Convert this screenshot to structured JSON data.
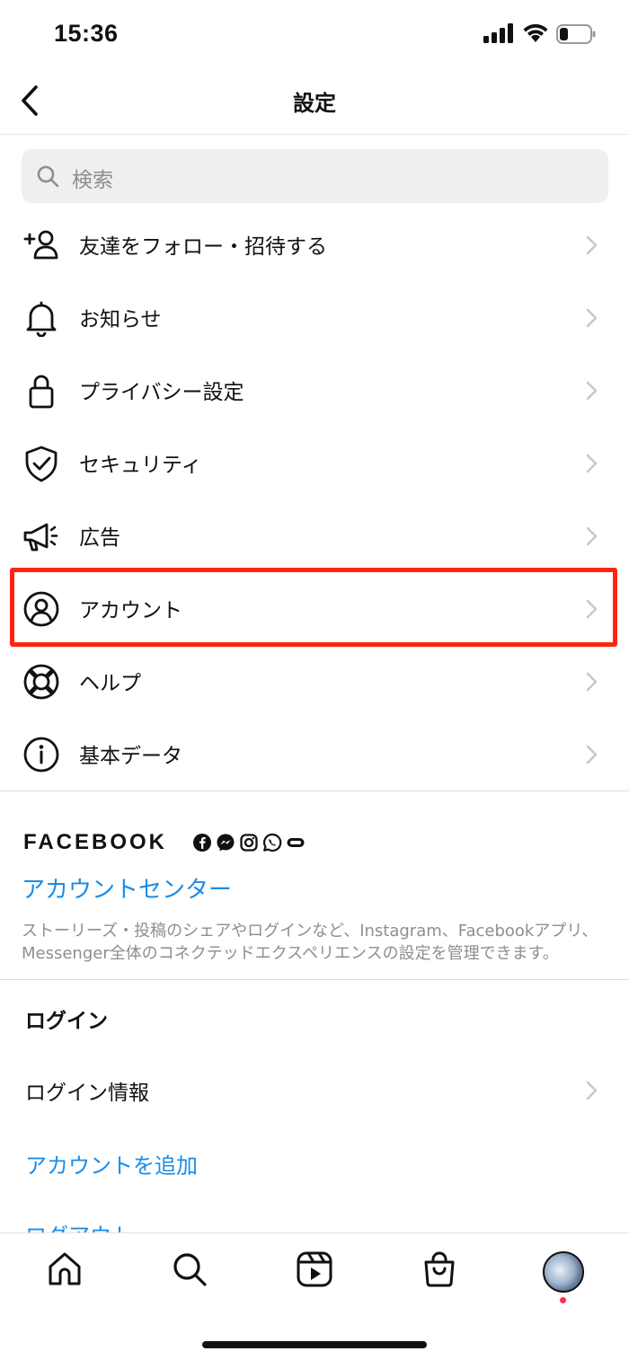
{
  "status_bar": {
    "time": "15:36"
  },
  "header": {
    "title": "設定"
  },
  "search": {
    "placeholder": "検索"
  },
  "menu": [
    {
      "label": "友達をフォロー・招待する",
      "icon": "add-person-icon"
    },
    {
      "label": "お知らせ",
      "icon": "bell-icon"
    },
    {
      "label": "プライバシー設定",
      "icon": "lock-icon"
    },
    {
      "label": "セキュリティ",
      "icon": "shield-check-icon"
    },
    {
      "label": "広告",
      "icon": "megaphone-icon"
    },
    {
      "label": "アカウント",
      "icon": "account-circle-icon",
      "highlighted": true
    },
    {
      "label": "ヘルプ",
      "icon": "lifebuoy-icon"
    },
    {
      "label": "基本データ",
      "icon": "info-icon"
    }
  ],
  "facebook": {
    "wordmark": "FACEBOOK",
    "account_center": "アカウントセンター",
    "description": "ストーリーズ・投稿のシェアやログインなど、Instagram、Facebookアプリ、Messenger全体のコネクテッドエクスペリエンスの設定を管理できます。"
  },
  "login_section": {
    "heading": "ログイン",
    "login_info": "ログイン情報",
    "add_account": "アカウントを追加",
    "logout": "ログアウト"
  },
  "colors": {
    "link": "#1a8ce8",
    "highlight": "#ff2412",
    "notification_dot": "#ff3040"
  }
}
